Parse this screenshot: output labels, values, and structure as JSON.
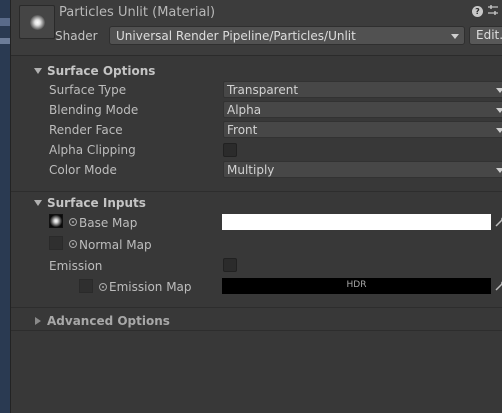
{
  "header": {
    "title": "Particles Unlit (Material)",
    "shader_label": "Shader",
    "shader_value": "Universal Render Pipeline/Particles/Unlit",
    "edit_label": "Edit..."
  },
  "sections": {
    "surface_options": {
      "title": "Surface Options",
      "surface_type": {
        "label": "Surface Type",
        "value": "Transparent"
      },
      "blending_mode": {
        "label": "Blending Mode",
        "value": "Alpha"
      },
      "render_face": {
        "label": "Render Face",
        "value": "Front"
      },
      "alpha_clipping": {
        "label": "Alpha Clipping",
        "checked": false
      },
      "color_mode": {
        "label": "Color Mode",
        "value": "Multiply"
      }
    },
    "surface_inputs": {
      "title": "Surface Inputs",
      "base_map": {
        "label": "Base Map",
        "color": "#ffffff"
      },
      "normal_map": {
        "label": "Normal Map"
      },
      "emission": {
        "label": "Emission",
        "checked": false
      },
      "emission_map": {
        "label": "Emission Map",
        "color": "#000000",
        "badge": "HDR"
      }
    },
    "advanced_options": {
      "title": "Advanced Options",
      "expanded": false
    }
  },
  "icons": {
    "help": "question-circle-icon",
    "settings": "sliders-icon",
    "eyedropper": "eyedropper-icon"
  },
  "colors": {
    "panel_bg": "#383838",
    "field_bg": "#474747",
    "text": "#c4c4c4"
  }
}
